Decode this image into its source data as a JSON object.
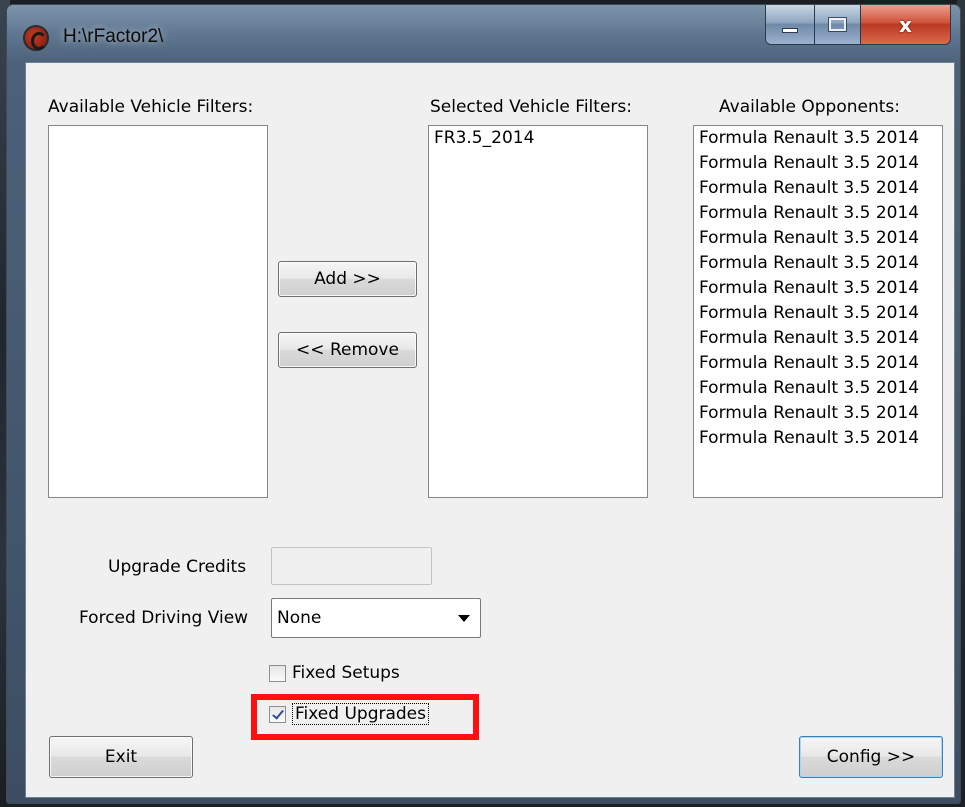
{
  "window": {
    "title": "H:\\rFactor2\\",
    "close_glyph": "x"
  },
  "labels": {
    "available_vehicle_filters": "Available Vehicle Filters:",
    "selected_vehicle_filters": "Selected Vehicle Filters:",
    "available_opponents": "Available Opponents:",
    "upgrade_credits": "Upgrade Credits",
    "forced_driving_view": "Forced Driving View"
  },
  "lists": {
    "available_vehicle_filters": [],
    "selected_vehicle_filters": [
      "FR3.5_2014"
    ],
    "available_opponents": [
      "Formula Renault 3.5 2014",
      "Formula Renault 3.5 2014",
      "Formula Renault 3.5 2014",
      "Formula Renault 3.5 2014",
      "Formula Renault 3.5 2014",
      "Formula Renault 3.5 2014",
      "Formula Renault 3.5 2014",
      "Formula Renault 3.5 2014",
      "Formula Renault 3.5 2014",
      "Formula Renault 3.5 2014",
      "Formula Renault 3.5 2014",
      "Formula Renault 3.5 2014",
      "Formula Renault 3.5 2014"
    ]
  },
  "buttons": {
    "add": "Add >>",
    "remove": "<< Remove",
    "exit": "Exit",
    "config": "Config >>"
  },
  "fields": {
    "upgrade_credits_value": "",
    "forced_driving_view_value": "None"
  },
  "checkboxes": {
    "fixed_setups": {
      "label": "Fixed Setups",
      "checked": false
    },
    "fixed_upgrades": {
      "label": "Fixed Upgrades",
      "checked": true
    }
  },
  "colors": {
    "highlight": "#ff1010",
    "title_bar": "#5e7690",
    "close_button": "#d1533c"
  },
  "icons": {
    "app": "rfactor-app-icon",
    "minimize": "minimize-icon",
    "maximize": "maximize-icon",
    "close": "close-icon",
    "dropdown": "chevron-down-icon",
    "check": "check-icon"
  }
}
